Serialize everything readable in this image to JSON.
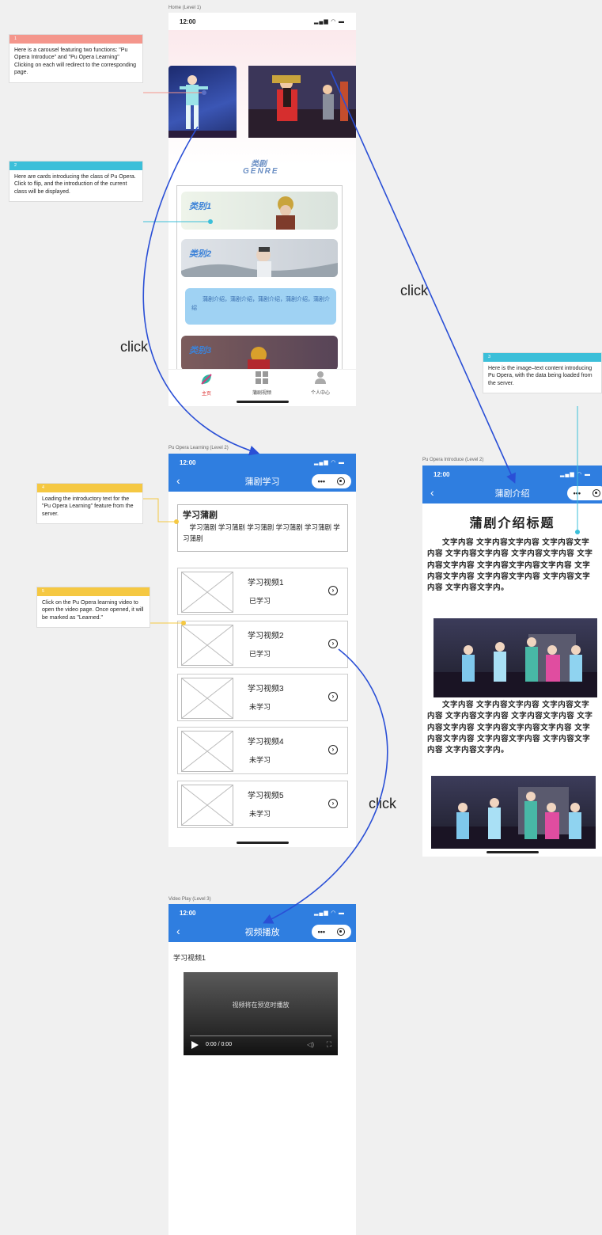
{
  "screens": {
    "home": {
      "label": "Home (Level 1)",
      "time": "12:00",
      "genre_title_cn": "类剧",
      "genre_title_en": "GENRE",
      "cards": [
        {
          "label": "类别1"
        },
        {
          "label": "类别2"
        },
        {
          "label": "类别3"
        }
      ],
      "flip_text": "蒲剧介绍，蒲剧介绍，蒲剧介绍，蒲剧介绍，蒲剧介绍",
      "tabs": [
        {
          "label": "主页",
          "icon": "home-leaf-icon"
        },
        {
          "label": "蒲剧视频",
          "icon": "grid-icon"
        },
        {
          "label": "个人中心",
          "icon": "person-icon"
        }
      ]
    },
    "learning": {
      "label": "Pu Opera Learning (Level 2)",
      "time": "12:00",
      "nav_title": "蒲剧学习",
      "intro_title": "学习蒲剧",
      "intro_text": "学习蒲剧 学习蒲剧 学习蒲剧  学习蒲剧 学习蒲剧 学习蒲剧",
      "videos": [
        {
          "title": "学习视频1",
          "status": "已学习"
        },
        {
          "title": "学习视频2",
          "status": "已学习"
        },
        {
          "title": "学习视频3",
          "status": "未学习"
        },
        {
          "title": "学习视频4",
          "status": "未学习"
        },
        {
          "title": "学习视频5",
          "status": "未学习"
        }
      ]
    },
    "introduce": {
      "label": "Pu Opera Introduce (Level 2)",
      "time": "12:00",
      "nav_title": "蒲剧介绍",
      "heading": "蒲剧介绍标题",
      "paragraph1": "文字内容 文字内容文字内容 文字内容文字内容 文字内容文字内容 文字内容文字内容 文字内容文字内容 文字内容文字内容文字内容 文字内容文字内容 文字内容文字内容 文字内容文字内容 文字内容文字内。",
      "paragraph2": "文字内容 文字内容文字内容 文字内容文字内容 文字内容文字内容 文字内容文字内容 文字内容文字内容 文字内容文字内容文字内容 文字内容文字内容 文字内容文字内容 文字内容文字内容 文字内容文字内。"
    },
    "video": {
      "label": "Video Play (Level 3)",
      "time": "12:00",
      "nav_title": "视频播放",
      "video_title": "学习视频1",
      "player_hint": "视频将在预览时播放",
      "player_time": "0:00 / 0:00"
    }
  },
  "annotations": [
    {
      "number": "1",
      "color": "#f4968c",
      "text": "Here is a carousel featuring two functions: \"Pu Opera Introduce\" and \"Pu Opera Learning\" Clicking on each will redirect to the corresponding page."
    },
    {
      "number": "2",
      "color": "#3bbfd9",
      "text": "Here are cards introducing the class of Pu Opera. Click to flip, and the introduction of the current class will be displayed."
    },
    {
      "number": "3",
      "color": "#3bbfd9",
      "text": "Here is the image–text content introducing Pu Opera, with the data being loaded from the server."
    },
    {
      "number": "4",
      "color": "#f5c842",
      "text": "Loading the introductory text for the \"Pu Opera Learning\" feature from the server."
    },
    {
      "number": "5",
      "color": "#f5c842",
      "text": "Click on the Pu Opera learning video to open the video page. Once opened, it will be marked as \"Learned.\""
    }
  ],
  "flow_labels": [
    "click",
    "click",
    "click"
  ],
  "colors": {
    "nav_blue": "#2f7ee0",
    "arrow_blue": "#2a4fd6",
    "card_flip_blue": "#9fd2f3"
  }
}
